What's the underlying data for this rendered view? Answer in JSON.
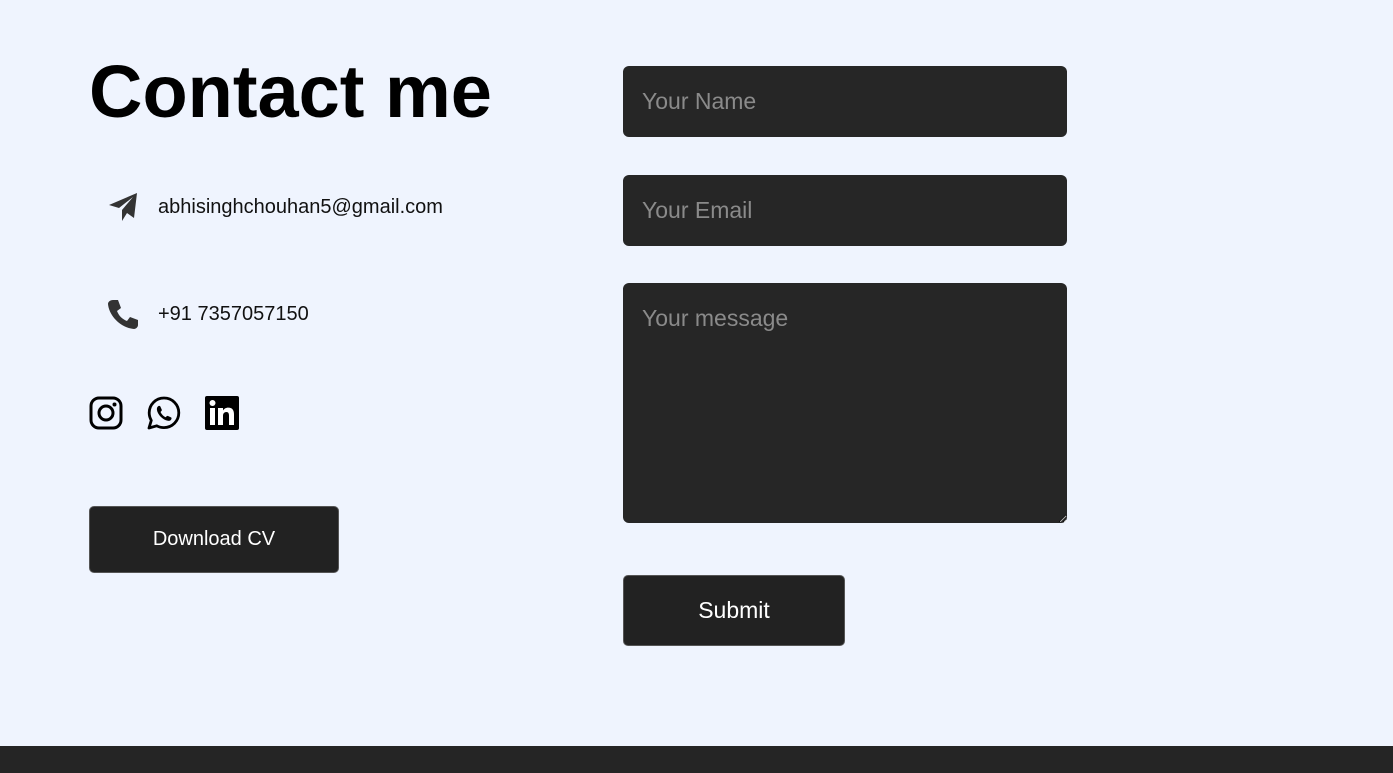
{
  "contact": {
    "title": "Contact me",
    "email": "abhisinghchouhan5@gmail.com",
    "phone": "+91 7357057150",
    "download_cv_label": "Download CV"
  },
  "socials": [
    {
      "name": "instagram-icon"
    },
    {
      "name": "whatsapp-icon"
    },
    {
      "name": "linkedin-icon"
    }
  ],
  "form": {
    "name_placeholder": "Your Name",
    "email_placeholder": "Your Email",
    "message_placeholder": "Your message",
    "submit_label": "Submit"
  },
  "colors": {
    "background": "#eff4fe",
    "dark": "#262626",
    "button": "#222222",
    "footer": "#252525"
  }
}
